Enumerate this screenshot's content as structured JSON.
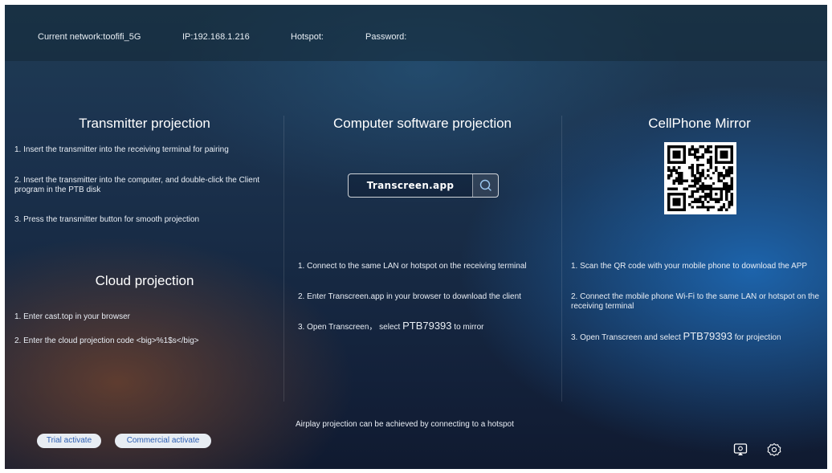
{
  "header": {
    "network": "Current network:toofifi_5G",
    "ip": "IP:192.168.1.216",
    "hotspot": "Hotspot:",
    "password": "Password:"
  },
  "transmitter": {
    "title": "Transmitter projection",
    "steps": [
      "1. Insert the transmitter into the receiving terminal for pairing",
      "2. Insert the transmitter into the computer, and double-click the Client program in the PTB disk",
      "3. Press the transmitter button for smooth projection"
    ]
  },
  "cloud": {
    "title": "Cloud projection",
    "steps": [
      "1. Enter cast.top in your browser",
      "2. Enter the cloud projection code <big>%1$s</big>"
    ]
  },
  "computer": {
    "title": "Computer software projection",
    "search_value": "Transcreen.app",
    "steps": [
      "1. Connect to the same LAN or hotspot on the receiving terminal",
      "2. Enter Transcreen.app in your browser to download the client"
    ],
    "step3_prefix": "3. Open Transcreen， select ",
    "step3_code": "PTB79393",
    "step3_suffix": " to mirror",
    "airplay_note": "Airplay projection can be achieved by connecting to a hotspot"
  },
  "cellphone": {
    "title": "CellPhone Mirror",
    "steps": [
      "1. Scan the QR code with your mobile phone to download the APP",
      "2. Connect the mobile phone Wi-Fi to the same LAN or hotspot on the receiving terminal"
    ],
    "step3_prefix": "3. Open Transcreen and select ",
    "step3_code": "PTB79393",
    "step3_suffix": " for projection"
  },
  "buttons": {
    "trial": "Trial activate",
    "commercial": "Commercial activate"
  },
  "icons": {
    "search": "search-icon",
    "qr": "qr-code",
    "cast": "cast-icon",
    "settings": "gear-icon"
  },
  "colors": {
    "pill_bg": "#e8edf3",
    "pill_text": "#2b5db3",
    "accent_blue": "#1e6ebe"
  }
}
